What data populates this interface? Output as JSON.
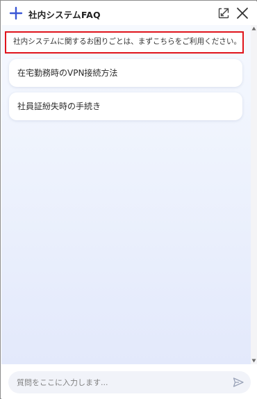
{
  "header": {
    "title": "社内システムFAQ",
    "plus_icon": "plus-icon",
    "minimize_icon": "minimize-icon",
    "close_icon": "close-icon",
    "accent_color": "#3b57d6"
  },
  "main": {
    "notice": "社内システムに関するお困りごとは、まずこちらをご利用ください。",
    "notice_border_color": "#e0141c",
    "faq_items": [
      {
        "label": "在宅勤務時のVPN接続方法"
      },
      {
        "label": "社員証紛失時の手続き"
      }
    ]
  },
  "footer": {
    "input_value": "",
    "input_placeholder": "質問をここに入力します...",
    "send_icon": "send-icon"
  }
}
